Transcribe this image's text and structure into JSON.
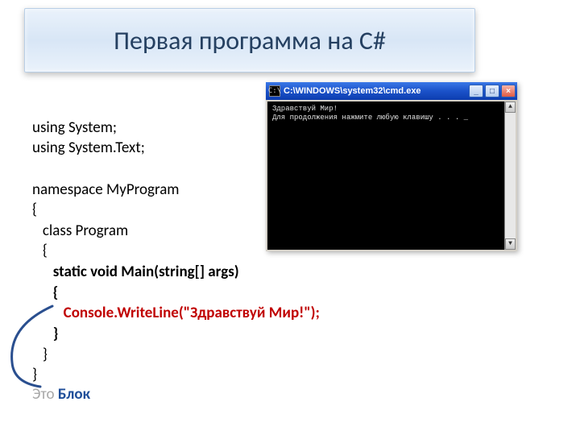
{
  "title": "Первая программа на C#",
  "code": {
    "l1": "using System;",
    "l2": "using System.Text;",
    "l3": "",
    "l4": "namespace MyProgram",
    "l5": "{",
    "l6": "   class Program",
    "l7": "   {",
    "l8": "      static void Main(string[] args)",
    "l9": "      {",
    "l10": "         Console.WriteLine(\"Здравствуй Мир!\");",
    "l11": "      }",
    "l12": "   }",
    "l13": "}"
  },
  "annotation": {
    "prefix": "Это ",
    "word": "Блок"
  },
  "cmd": {
    "title": "C:\\WINDOWS\\system32\\cmd.exe",
    "out1": "Здравствуй Мир!",
    "out2": "Для продолжения нажмите любую клавишу . . . _",
    "min": "_",
    "max": "□",
    "close": "×",
    "up": "▲",
    "down": "▼",
    "prompt": "C:\\"
  }
}
